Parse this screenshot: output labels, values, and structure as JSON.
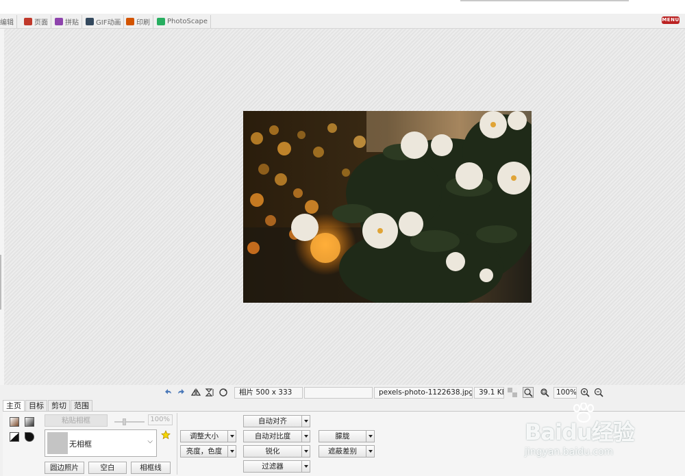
{
  "tabs": [
    {
      "label": "编辑",
      "icon": "edit-icon",
      "color": "#777777"
    },
    {
      "label": "页面",
      "icon": "page-icon",
      "color": "#c0392b"
    },
    {
      "label": "拼贴",
      "icon": "combine-icon",
      "color": "#8e44ad"
    },
    {
      "label": "GIF动画",
      "icon": "gif-animation-icon",
      "color": "#2c3e50"
    },
    {
      "label": "印刷",
      "icon": "print-icon",
      "color": "#d35400"
    },
    {
      "label": "PhotoScape",
      "icon": "photoscape-icon",
      "color": "#27ae60"
    }
  ],
  "menu_label": "MENU",
  "status": {
    "photo_size": "相片 500 x 333",
    "blank_field": "",
    "filename": "pexels-photo-1122638.jpg",
    "filesize": "39.1 KB",
    "zoom": "100%"
  },
  "toolbar_icons": [
    "undo-icon",
    "redo-icon",
    "flip-horizontal-icon",
    "flip-vertical-icon",
    "rotate-icon",
    "transparency-icon",
    "actual-size-icon",
    "fit-window-icon",
    "zoom-in-icon",
    "zoom-out-icon"
  ],
  "bottom_tabs": [
    "主页",
    "目标",
    "剪切",
    "范围"
  ],
  "home": {
    "paste_frame": "粘贴相框",
    "frame_percent": "100%",
    "frame_select": "无相框",
    "round_photo": "圆边照片",
    "blank": "空白",
    "frame_line": "相框线",
    "resize": "调整大小",
    "brightness_color": "亮度，色度",
    "auto_align": "自动对齐",
    "auto_contrast": "自动对比度",
    "sharpen": "锐化",
    "filter": "过滤器",
    "bloom": "朦胧",
    "backlight_correction": "遮蔽差别"
  },
  "watermark": {
    "brand": "Baidu经验",
    "url": "jingyan.baidu.com"
  },
  "colors": {
    "accent_menu": "#bb2222",
    "canvas": "#e3e3e3",
    "panel": "#f0f0f0"
  }
}
